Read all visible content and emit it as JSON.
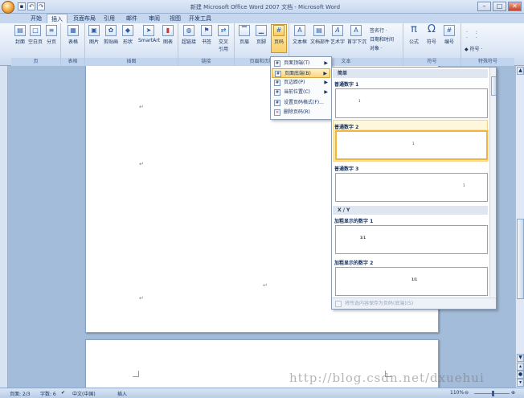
{
  "window": {
    "title": "新建 Microsoft Office Word 2007 文档 - Microsoft Word",
    "controls": [
      "–",
      "□",
      "✕"
    ]
  },
  "tabs": [
    {
      "label": "开始"
    },
    {
      "label": "插入",
      "active": true
    },
    {
      "label": "页面布局"
    },
    {
      "label": "引用"
    },
    {
      "label": "邮件"
    },
    {
      "label": "审阅"
    },
    {
      "label": "视图"
    },
    {
      "label": "开发工具"
    }
  ],
  "ribbon": {
    "groups": {
      "pages": "页",
      "tables": "表格",
      "illustrations": "插图",
      "links": "链接",
      "header_footer": "页眉和页脚",
      "text": "文本",
      "symbols": "符号",
      "special_symbols": "特殊符号"
    },
    "buttons": {
      "cover": "封面",
      "blank_page": "空白页",
      "page_break": "分页",
      "table": "表格",
      "picture": "图片",
      "clipart": "剪贴画",
      "shapes": "形状",
      "smartart": "SmartArt",
      "chart": "图表",
      "hyperlink": "超链接",
      "bookmark": "书签",
      "crossref": "交叉\n引用",
      "header": "页眉",
      "footer": "页脚",
      "page_number": "页码",
      "textbox": "文本框",
      "quickparts": "文档部件",
      "wordart": "艺术字",
      "dropcap": "首字下沉",
      "signature": "签名行 ·",
      "datetime": "日期和时间",
      "object": "对象 ·",
      "equation": "公式",
      "symbol": "符号",
      "number": "编号",
      "special_symbol": "◆ 符号 ·"
    }
  },
  "menu": {
    "items": [
      {
        "label": "页面顶端(T)",
        "submenu": true
      },
      {
        "label": "页面底端(B)",
        "submenu": true,
        "highlighted": true
      },
      {
        "label": "页边距(P)",
        "submenu": true
      },
      {
        "label": "当前位置(C)",
        "submenu": true
      },
      {
        "label": "设置页码格式(F)..."
      },
      {
        "label": "删除页码(R)"
      }
    ]
  },
  "gallery": {
    "sections": [
      {
        "header": "简单",
        "items": [
          {
            "title": "普通数字 1",
            "sample": "1"
          },
          {
            "title": "普通数字 2",
            "sample": "1",
            "selected": true
          },
          {
            "title": "普通数字 3",
            "sample": "1"
          }
        ]
      },
      {
        "header": "X / Y",
        "items": [
          {
            "title": "加粗显示的数字 1",
            "sample": "1/1"
          },
          {
            "title": "加粗显示的数字 2",
            "sample": "1/1"
          }
        ]
      }
    ],
    "footer": "将所选内容保存为页码(底端)(S)"
  },
  "status": {
    "page": "页面: 2/3",
    "words": "字数: 6",
    "language": "中文(中国)",
    "mode": "插入",
    "zoom": "110%"
  },
  "watermark": "http://blog.csdn.net/dxuehui"
}
